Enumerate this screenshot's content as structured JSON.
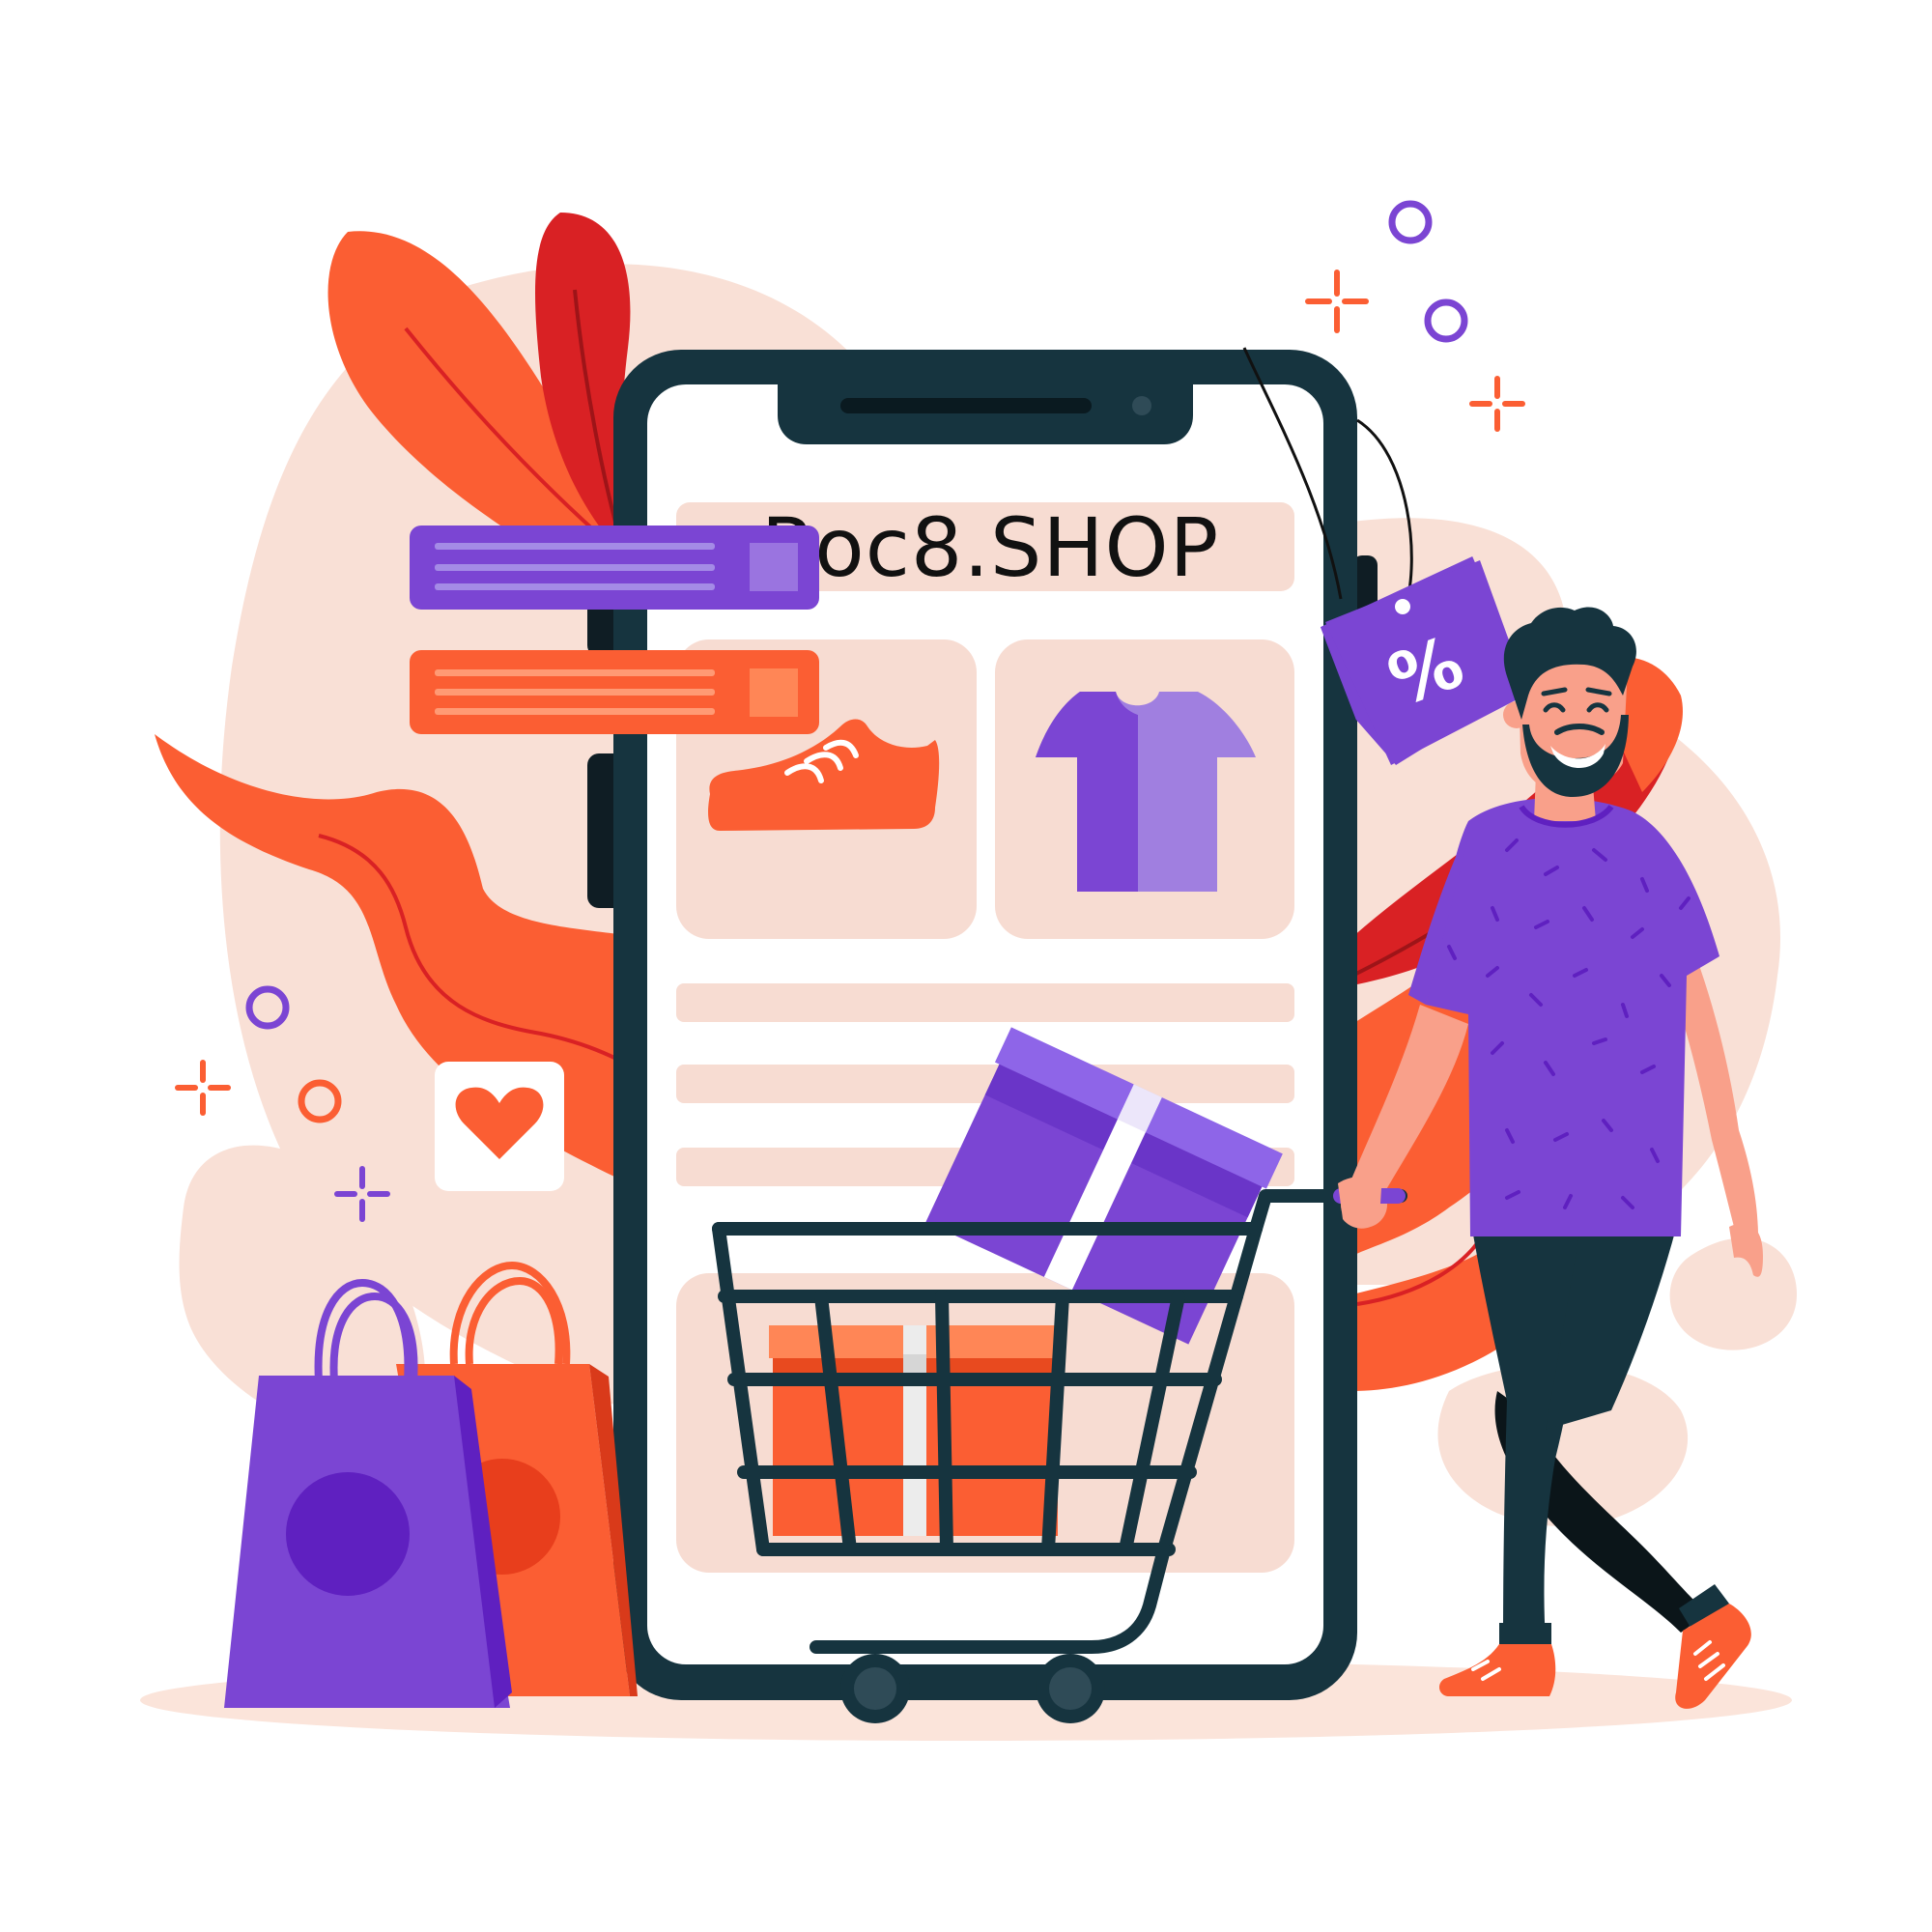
{
  "shop": {
    "title": "Roc8.SHOP"
  },
  "discount_tag": {
    "symbol": "%"
  },
  "colors": {
    "purple": "#7b45d3",
    "purple_light": "#a07fe0",
    "purple_dark": "#5f20c0",
    "orange": "#fb5e33",
    "orange_light": "#ff8656",
    "red": "#d92124",
    "blush": "#f7dcd2",
    "navy": "#16343f",
    "screen": "#ffffff",
    "skin": "#f9a08a"
  },
  "icons": {
    "sneaker": "sneaker-icon",
    "tshirt": "tshirt-icon",
    "heart": "heart-icon",
    "cart": "shopping-cart-icon",
    "gift": "gift-box-icon",
    "bag": "shopping-bag-icon",
    "percent": "percent-tag-icon"
  }
}
